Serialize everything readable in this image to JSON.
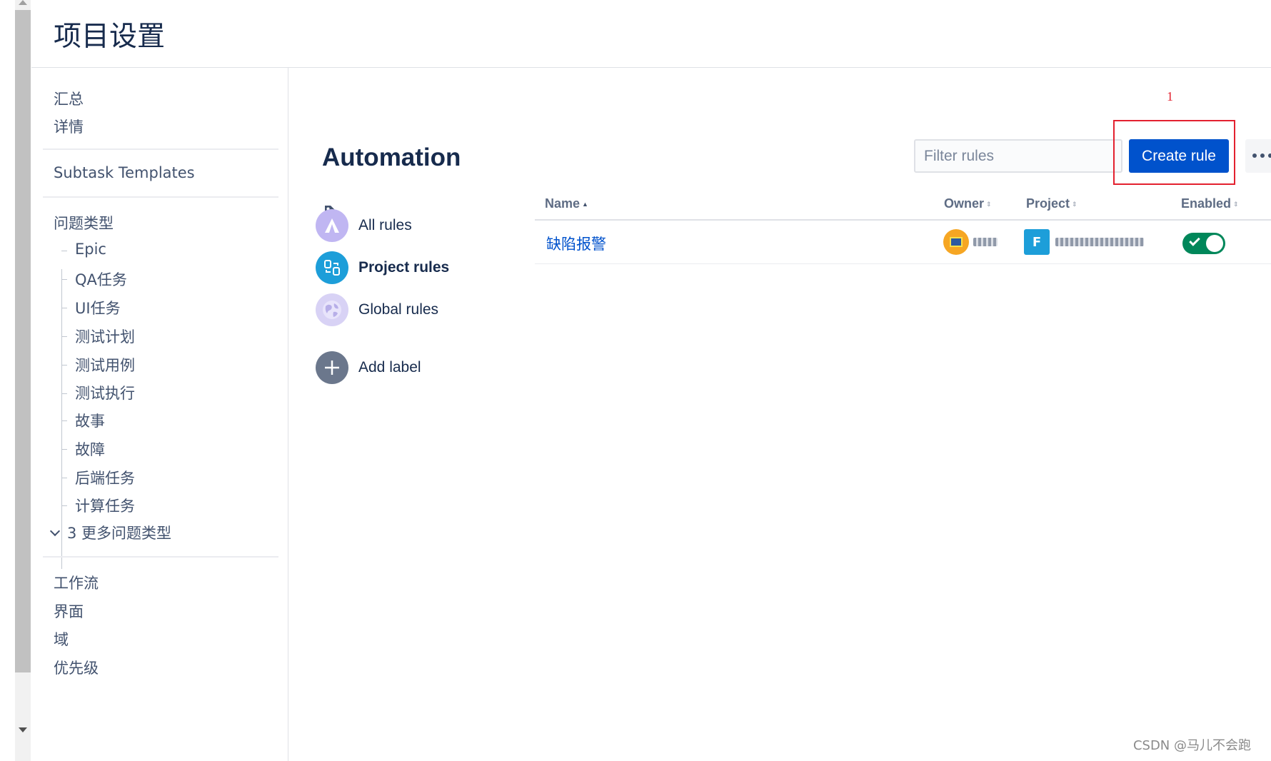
{
  "header": {
    "title": "项目设置"
  },
  "sidebar": {
    "top_items": [
      "汇总",
      "详情"
    ],
    "subtask_templates": "Subtask Templates",
    "issue_types_title": "问题类型",
    "issue_types": [
      "Epic",
      "QA任务",
      "UI任务",
      "测试计划",
      "测试用例",
      "测试执行",
      "故事",
      "故障",
      "后端任务",
      "计算任务"
    ],
    "more_issue_types": "3 更多问题类型",
    "bottom_items": [
      "工作流",
      "界面",
      "域",
      "优先级"
    ]
  },
  "main": {
    "title": "Automation",
    "filter": {
      "placeholder": "Filter rules",
      "value": ""
    },
    "create_button": "Create rule",
    "annotation_number": "1",
    "labels": [
      {
        "label": "All rules",
        "icon": "automation-logo-icon",
        "color": "#c0b6f2"
      },
      {
        "label": "Project rules",
        "icon": "project-rules-icon",
        "color": "#1d9ed9",
        "active": true
      },
      {
        "label": "Global rules",
        "icon": "globe-icon",
        "color": "#d8d2f5"
      },
      {
        "label": "Add label",
        "icon": "plus-icon",
        "color": "#6b778c"
      }
    ],
    "table": {
      "columns": [
        "Name",
        "Owner",
        "Project",
        "Enabled"
      ],
      "rows": [
        {
          "name": "缺陷报警",
          "enabled": true
        }
      ]
    }
  },
  "watermark": "CSDN @马儿不会跑",
  "colors": {
    "primary": "#0052cc",
    "success": "#00875a",
    "annotation": "#e3212f"
  }
}
